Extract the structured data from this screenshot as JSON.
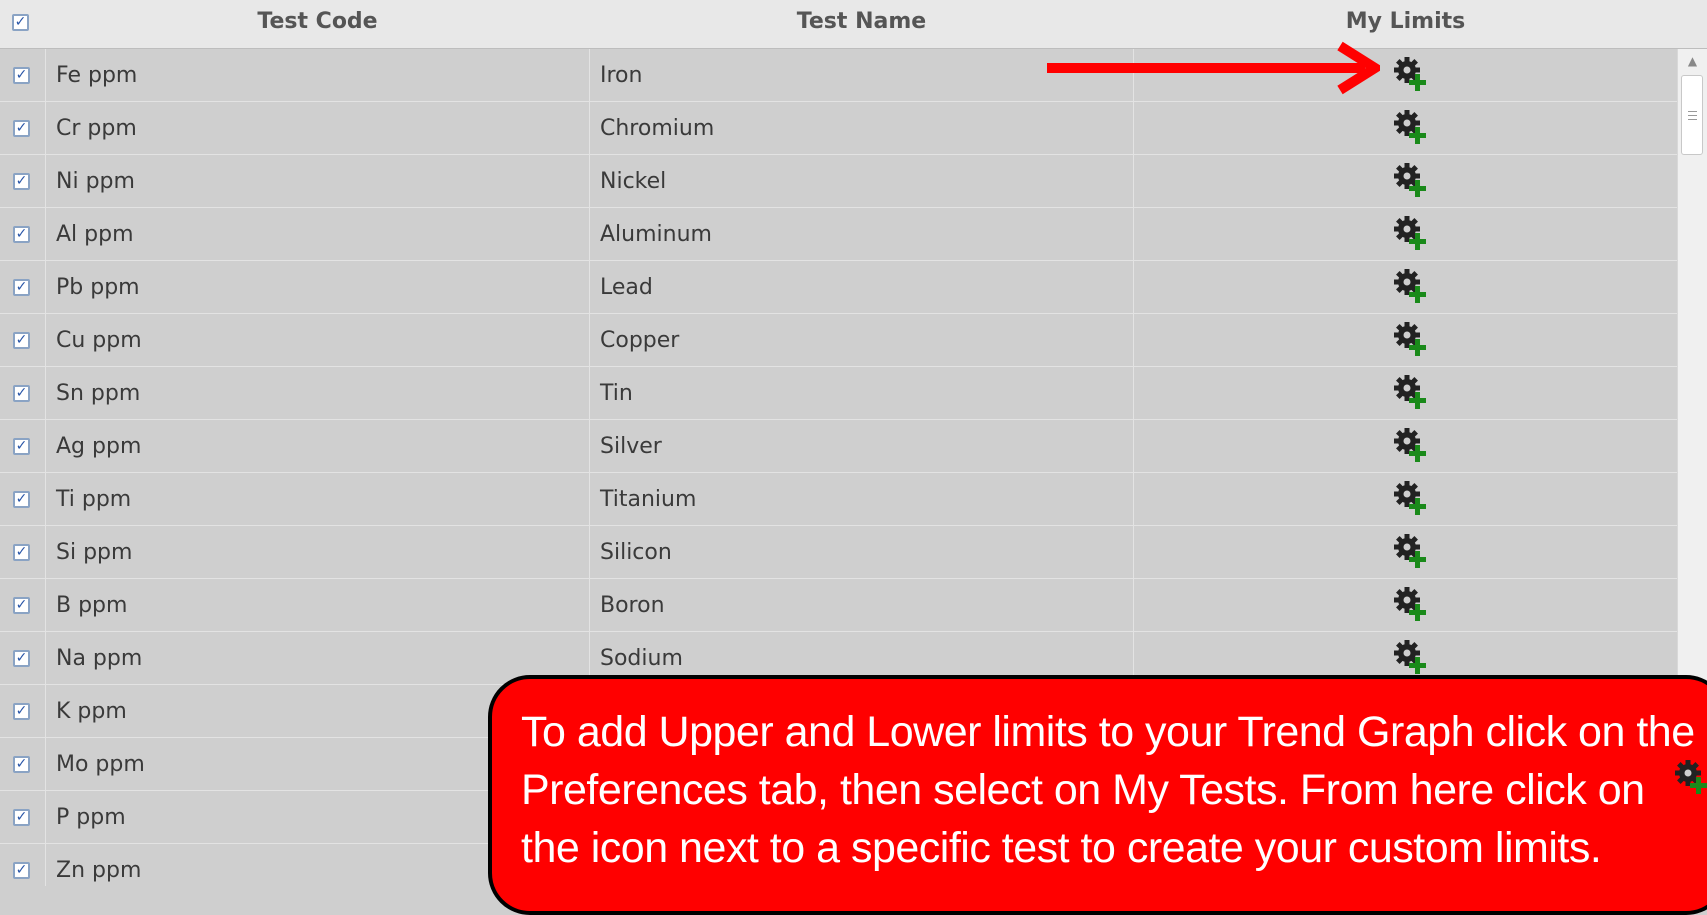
{
  "header": {
    "col_code": "Test Code",
    "col_name": "Test Name",
    "col_limits": "My Limits"
  },
  "rows": [
    {
      "code": "Fe ppm",
      "name": "Iron"
    },
    {
      "code": "Cr ppm",
      "name": "Chromium"
    },
    {
      "code": "Ni ppm",
      "name": "Nickel"
    },
    {
      "code": "Al ppm",
      "name": "Aluminum"
    },
    {
      "code": "Pb ppm",
      "name": "Lead"
    },
    {
      "code": "Cu ppm",
      "name": "Copper"
    },
    {
      "code": "Sn ppm",
      "name": "Tin"
    },
    {
      "code": "Ag ppm",
      "name": "Silver"
    },
    {
      "code": "Ti ppm",
      "name": "Titanium"
    },
    {
      "code": "Si ppm",
      "name": "Silicon"
    },
    {
      "code": "B ppm",
      "name": "Boron"
    },
    {
      "code": "Na ppm",
      "name": "Sodium"
    },
    {
      "code": "K ppm",
      "name": ""
    },
    {
      "code": "Mo ppm",
      "name": ""
    },
    {
      "code": "P ppm",
      "name": ""
    },
    {
      "code": "Zn ppm",
      "name": ""
    }
  ],
  "callout": {
    "text": "To add Upper and Lower limits to your Trend Graph click on the Preferences tab, then select on My Tests.   From here click on the icon next to a specific test to create your custom limits."
  },
  "icons": {
    "limit_icon": "gear-plus-icon",
    "checkbox": "checkbox-checked"
  },
  "colors": {
    "callout_bg": "#ff0000",
    "arrow": "#ff0000",
    "plus": "#1a8a1a"
  }
}
